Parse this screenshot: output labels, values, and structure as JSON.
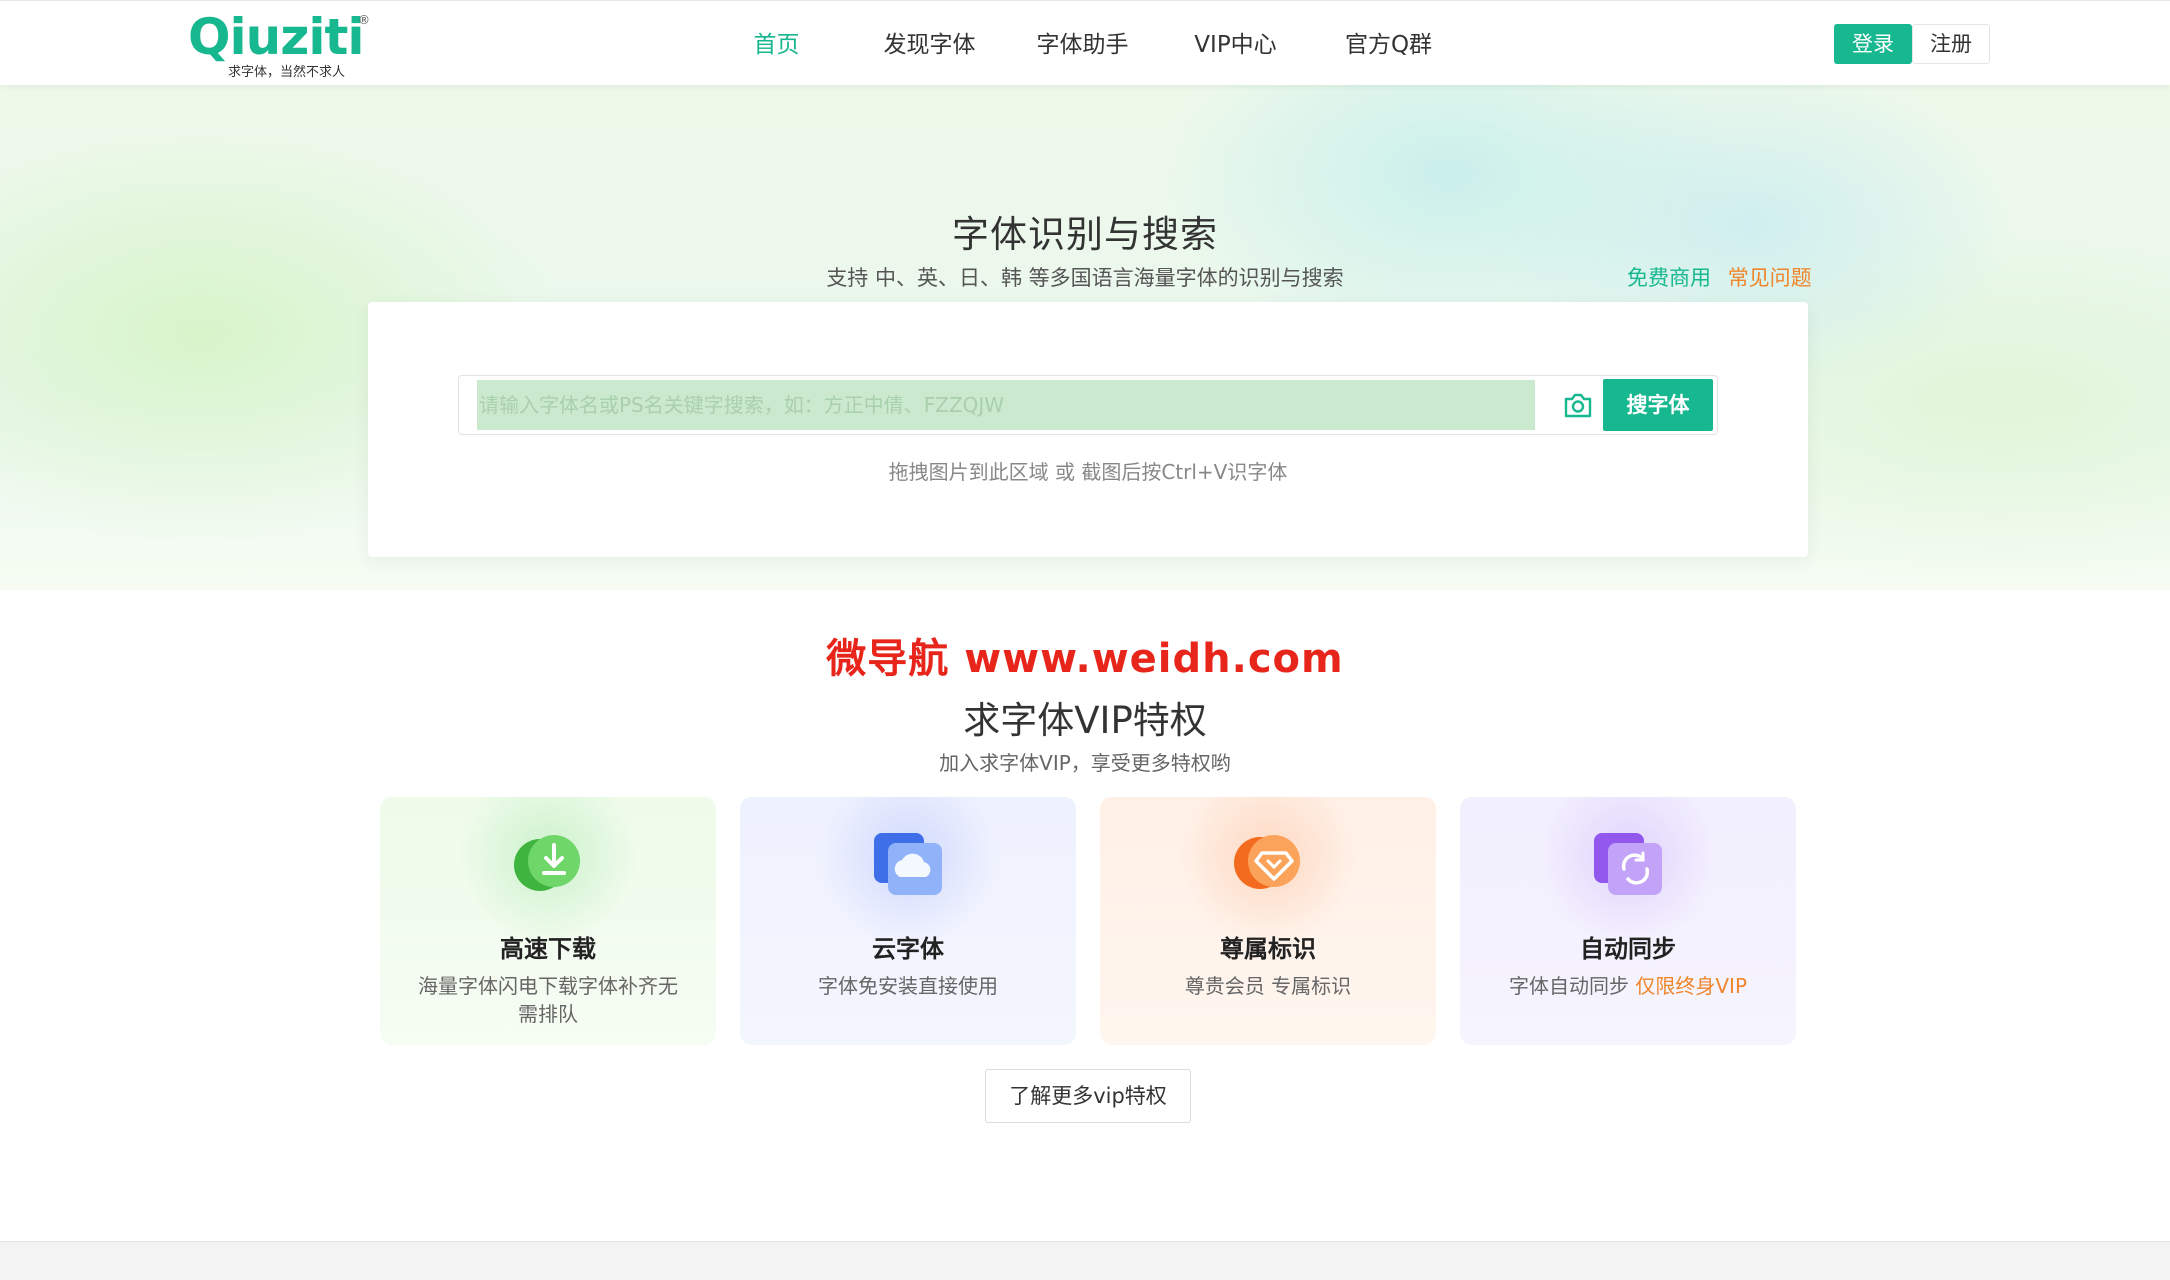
{
  "brand": {
    "logo_text": "Qiuziti",
    "registered_mark": "®",
    "slogan": "求字体，当然不求人",
    "accent_color": "#17b78f",
    "link_orange": "#f0862c",
    "watermark_color": "#e8251a"
  },
  "nav": {
    "items": [
      {
        "label": "首页",
        "active": true
      },
      {
        "label": "发现字体",
        "active": false
      },
      {
        "label": "字体助手",
        "active": false
      },
      {
        "label": "VIP中心",
        "active": false
      },
      {
        "label": "官方Q群",
        "active": false
      }
    ],
    "login_label": "登录",
    "register_label": "注册"
  },
  "hero": {
    "title": "字体识别与搜索",
    "subtitle": "支持 中、英、日、韩 等多国语言海量字体的识别与搜索",
    "link_free": "免费商用",
    "link_faq": "常见问题",
    "search_placeholder": "请输入字体名或PS名关键字搜索，如：方正中倩、FZZQJW",
    "search_value": "",
    "camera_icon": "camera-icon",
    "search_button": "搜字体",
    "drop_hint": "拖拽图片到此区域 或 截图后按Ctrl+V识字体"
  },
  "watermark": "微导航 www.weidh.com",
  "vip": {
    "title": "求字体VIP特权",
    "subtitle": "加入求字体VIP，享受更多特权哟",
    "cards": [
      {
        "icon": "download-icon",
        "title": "高速下载",
        "desc": "海量字体闪电下载字体补齐无需排队",
        "desc_accent": ""
      },
      {
        "icon": "cloud-icon",
        "title": "云字体",
        "desc": "字体免安装直接使用",
        "desc_accent": ""
      },
      {
        "icon": "diamond-badge-icon",
        "title": "尊属标识",
        "desc": "尊贵会员 专属标识",
        "desc_accent": ""
      },
      {
        "icon": "sync-icon",
        "title": "自动同步",
        "desc": "字体自动同步 ",
        "desc_accent": "仅限终身VIP"
      }
    ],
    "more_button": "了解更多vip特权"
  }
}
